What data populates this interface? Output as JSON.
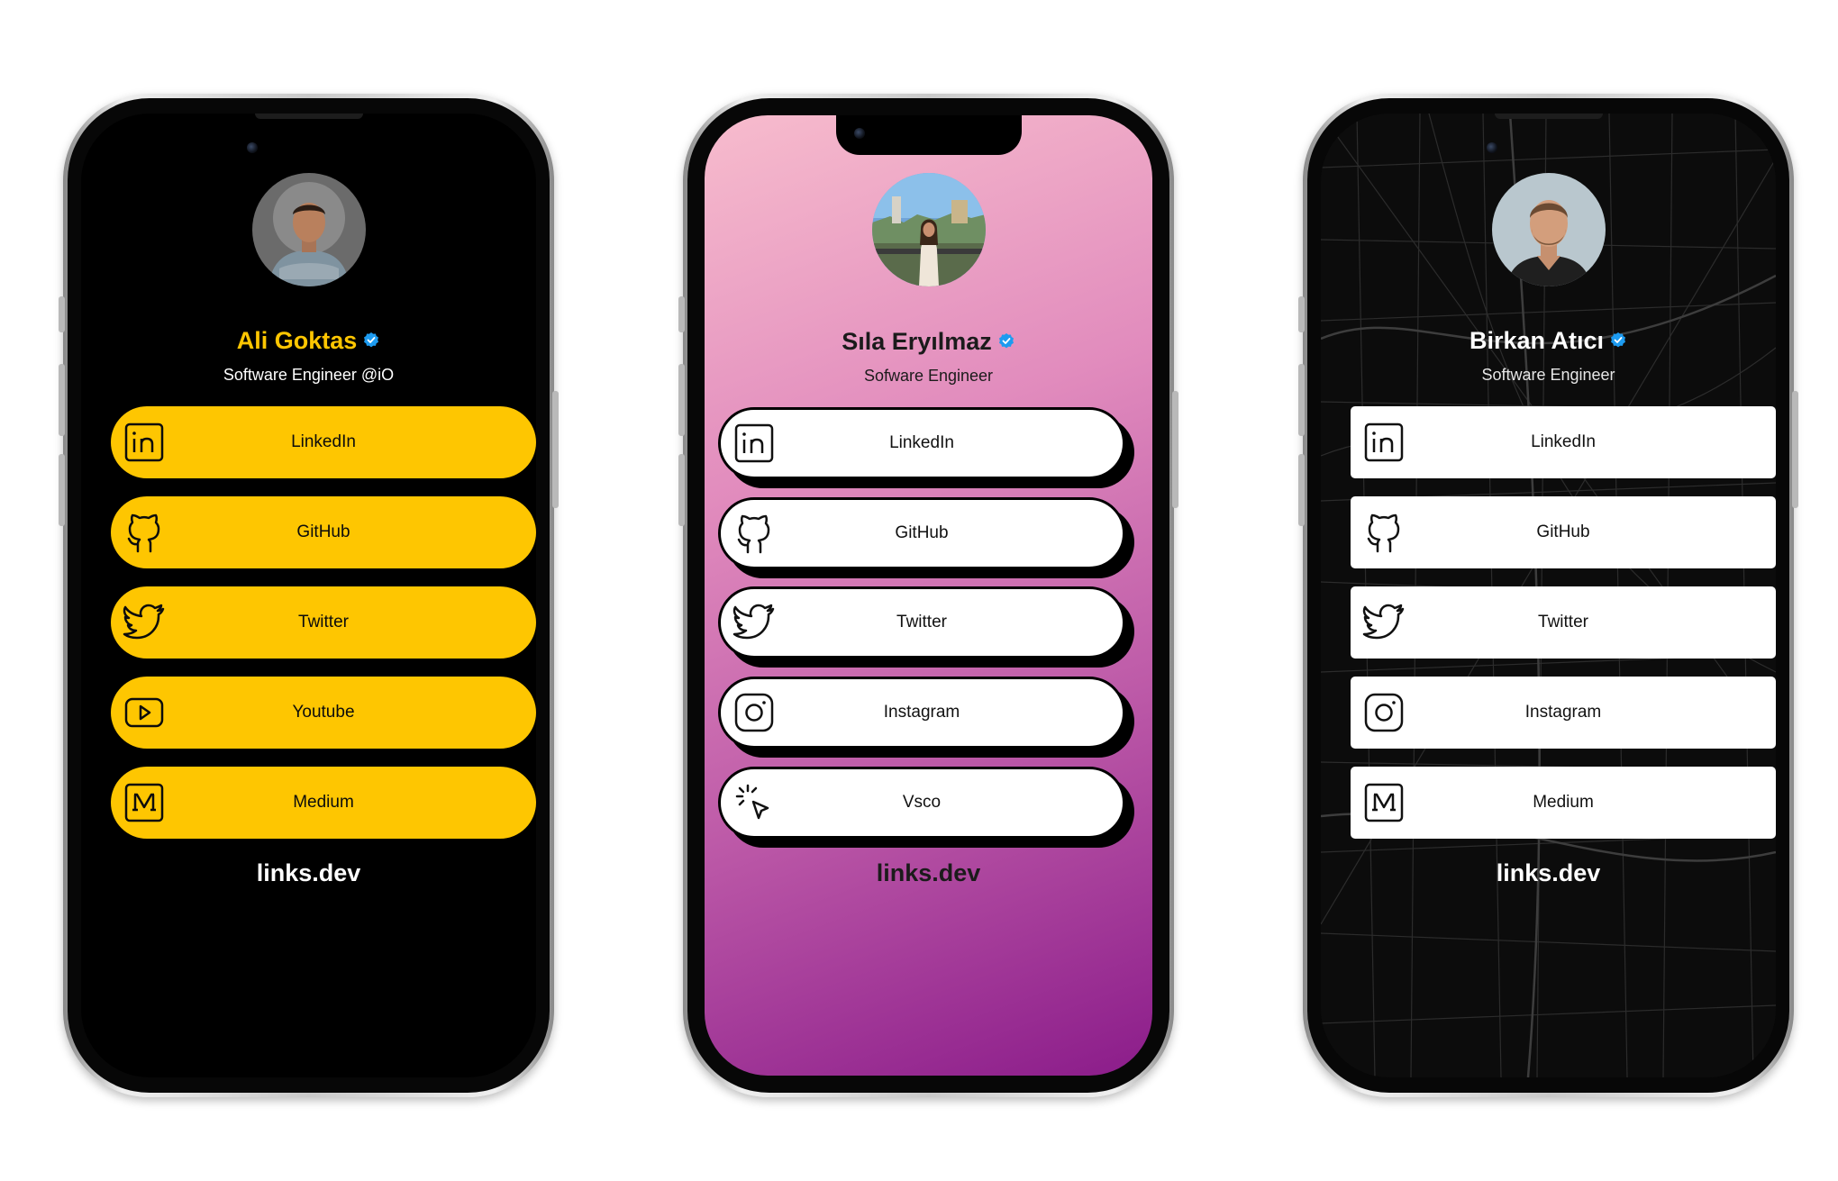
{
  "phones": [
    {
      "name": "Ali Goktas",
      "subtitle": "Software Engineer @iO",
      "links": [
        "LinkedIn",
        "GitHub",
        "Twitter",
        "Youtube",
        "Medium"
      ],
      "footer": "links.dev",
      "theme": {
        "background": "#000000",
        "button": "#fec601",
        "name": "#fec601"
      }
    },
    {
      "name": "Sıla Eryılmaz",
      "subtitle": "Sofware Engineer",
      "links": [
        "LinkedIn",
        "GitHub",
        "Twitter",
        "Instagram",
        "Vsco"
      ],
      "footer": "links.dev",
      "theme": {
        "gradient_start": "#f7bccd",
        "gradient_end": "#8b1c8a",
        "button": "#ffffff"
      }
    },
    {
      "name": "Birkan Atıcı",
      "subtitle": "Software Engineer",
      "links": [
        "LinkedIn",
        "GitHub",
        "Twitter",
        "Instagram",
        "Medium"
      ],
      "footer": "links.dev",
      "theme": {
        "background": "#0c0c0c",
        "button": "#ffffff"
      }
    }
  ],
  "icons": {
    "linkedin": "linkedin-icon",
    "github": "github-icon",
    "twitter": "twitter-icon",
    "youtube": "youtube-icon",
    "instagram": "instagram-icon",
    "vsco": "vsco-icon",
    "medium": "medium-icon",
    "verified": "verified-badge-icon"
  },
  "accent_colors": {
    "verified": "#1d9bf0"
  }
}
